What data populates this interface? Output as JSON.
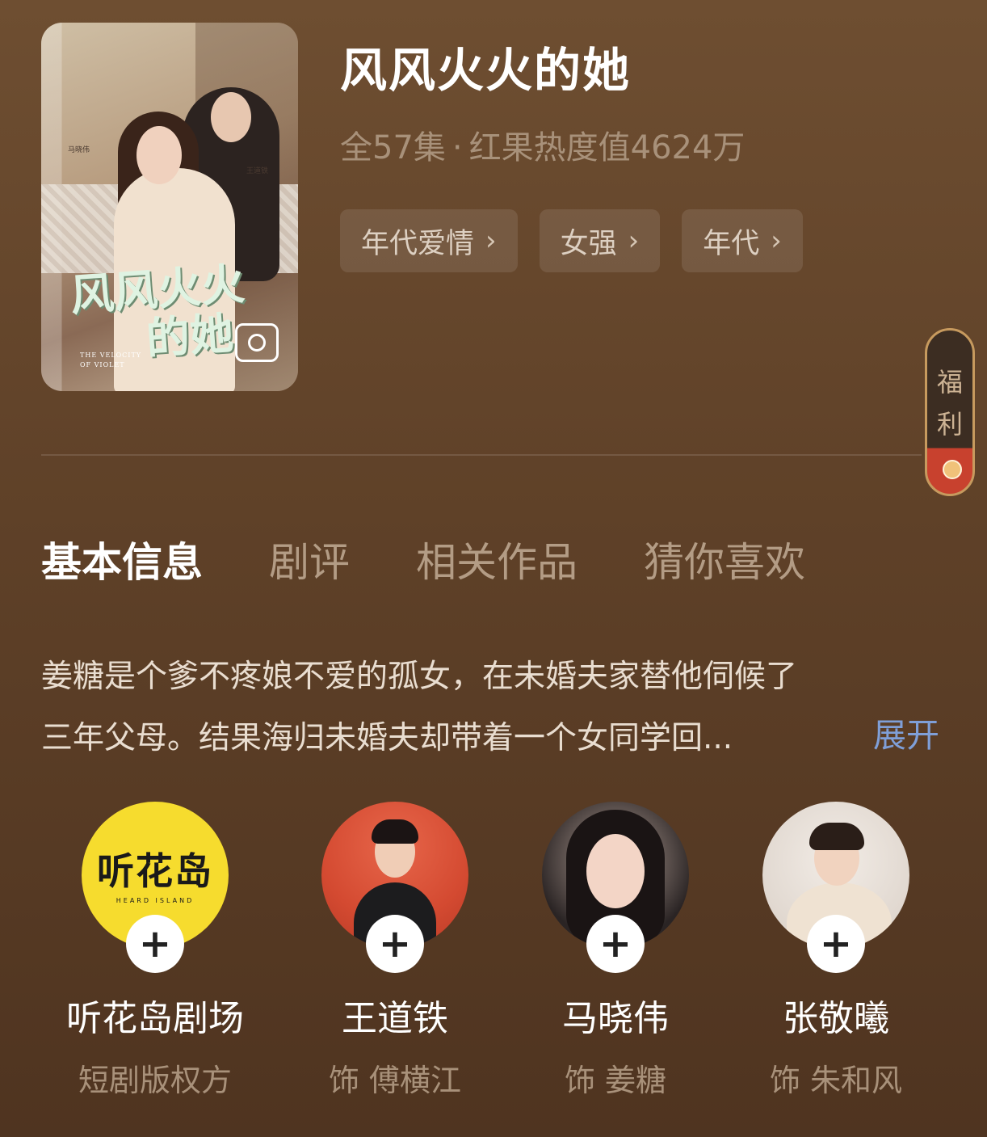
{
  "drama": {
    "title": "风风火火的她",
    "episodes": "全57集",
    "separator": "·",
    "heat": "红果热度值4624万"
  },
  "poster": {
    "art_title_line1": "风风火火",
    "art_title_line2": "的她",
    "english_title_line1": "THE VELOCITY",
    "english_title_line2": "OF VIOLET",
    "caption_left": "马晓伟",
    "caption_right": "王道铁"
  },
  "tags": [
    {
      "label": "年代爱情",
      "icon": "chevron-right-icon"
    },
    {
      "label": "女强",
      "icon": "chevron-right-icon"
    },
    {
      "label": "年代",
      "icon": "chevron-right-icon"
    }
  ],
  "welfare": {
    "label_1": "福",
    "label_2": "利"
  },
  "tabs": [
    {
      "label": "基本信息",
      "active": true
    },
    {
      "label": "剧评",
      "active": false
    },
    {
      "label": "相关作品",
      "active": false
    },
    {
      "label": "猜你喜欢",
      "active": false
    }
  ],
  "synopsis": {
    "line1": "姜糖是个爹不疼娘不爱的孤女，在未婚夫家替他伺候了",
    "line2": "三年父母。结果海归未婚夫却带着一个女同学回...",
    "expand": "展开"
  },
  "cast": [
    {
      "name": "听花岛剧场",
      "role": "短剧版权方",
      "logo": "听花岛",
      "logo_sub": "HEARD ISLAND"
    },
    {
      "name": "王道铁",
      "role": "饰 傅横江"
    },
    {
      "name": "马晓伟",
      "role": "饰 姜糖"
    },
    {
      "name": "张敬曦",
      "role": "饰 朱和风"
    }
  ],
  "colors": {
    "background": "#6e4e31",
    "accent_link": "#7f9fd8",
    "muted_text": "#a8917a",
    "studio_yellow": "#f6dc2e"
  }
}
